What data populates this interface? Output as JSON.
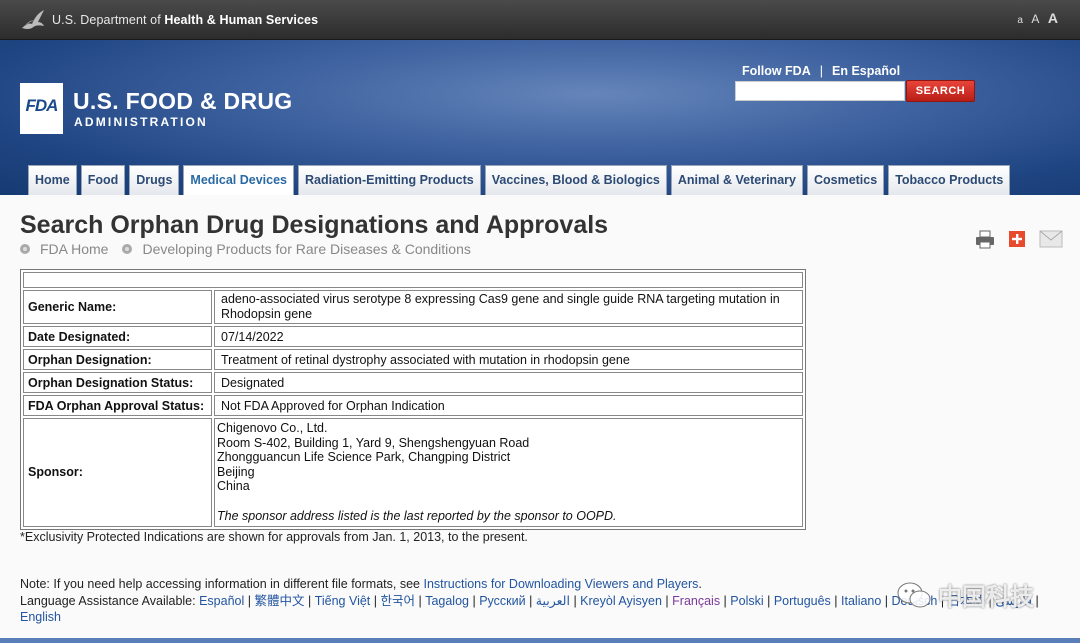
{
  "hhs": {
    "prefix": "U.S. Department of ",
    "bold": "Health & Human Services",
    "textsize": [
      "a",
      "A",
      "A"
    ]
  },
  "header": {
    "logo_text": "FDA",
    "title": "U.S. FOOD & DRUG",
    "subtitle": "ADMINISTRATION",
    "follow": "Follow FDA",
    "espanol": "En Español",
    "search_placeholder": "",
    "search_button": "SEARCH"
  },
  "tabs": [
    {
      "label": "Home"
    },
    {
      "label": "Food"
    },
    {
      "label": "Drugs"
    },
    {
      "label": "Medical Devices"
    },
    {
      "label": "Radiation-Emitting Products"
    },
    {
      "label": "Vaccines, Blood & Biologics"
    },
    {
      "label": "Animal & Veterinary"
    },
    {
      "label": "Cosmetics"
    },
    {
      "label": "Tobacco Products"
    }
  ],
  "page": {
    "title": "Search Orphan Drug Designations and Approvals",
    "breadcrumbs": [
      "FDA Home",
      "Developing Products for Rare Diseases & Conditions"
    ]
  },
  "details": {
    "generic_name_label": "Generic Name:",
    "generic_name": "adeno-associated virus serotype 8 expressing Cas9 gene and single guide RNA targeting mutation in Rhodopsin gene",
    "date_label": "Date Designated:",
    "date": "07/14/2022",
    "designation_label": "Orphan Designation:",
    "designation": "Treatment of retinal dystrophy associated with mutation in rhodopsin gene",
    "status_label": "Orphan Designation Status:",
    "status": "Designated",
    "approval_label": "FDA Orphan Approval Status:",
    "approval": "Not FDA Approved for Orphan Indication",
    "sponsor_label": "Sponsor:",
    "sponsor_lines": [
      "Chigenovo Co., Ltd.",
      "Room S-402, Building 1, Yard 9, Shengshengyuan Road",
      "Zhongguancun Life Science Park, Changping District",
      "Beijing",
      "China"
    ],
    "sponsor_note": "The sponsor address listed is the last reported by the sponsor to OOPD."
  },
  "footer": {
    "exclusivity": "*Exclusivity Protected Indications are shown for approvals from Jan. 1, 2013, to the present.",
    "note_prefix": "Note: If you need help accessing information in different file formats, see ",
    "note_link": "Instructions for Downloading Viewers and Players",
    "note_suffix": ".",
    "lang_prefix": "Language Assistance Available: ",
    "languages": [
      "Español",
      "繁體中文",
      "Tiếng Việt",
      "한국어",
      "Tagalog",
      "Русский",
      "العربية",
      "Kreyòl Ayisyen",
      "Français",
      "Polski",
      "Português",
      "Italiano",
      "Deutsch",
      "日本語",
      "فارسی",
      "English"
    ]
  },
  "watermark": {
    "text": "中国科技"
  },
  "colors": {
    "header_blue": "#1f4582",
    "search_red": "#c8261d",
    "link_blue": "#2255a0",
    "tab_text": "#2c4a74"
  }
}
